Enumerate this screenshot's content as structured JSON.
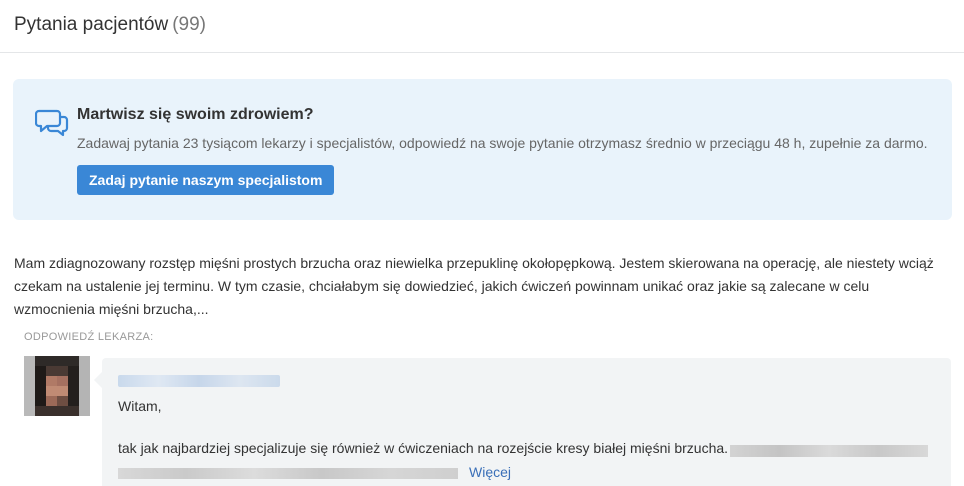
{
  "header": {
    "title": "Pytania pacjentów",
    "count": "(99)"
  },
  "banner": {
    "icon": "chat-bubbles-icon",
    "title": "Martwisz się swoim zdrowiem?",
    "description": "Zadawaj pytania 23 tysiącom lekarzy i specjalistów, odpowiedź na swoje pytanie otrzymasz średnio w przeciągu 48 h, zupełnie za darmo.",
    "button_label": "Zadaj pytanie naszym specjalistom"
  },
  "question": {
    "text": "Mam zdiagnozowany rozstęp mięśni prostych brzucha oraz niewielka przepuklinę okołopępkową. Jestem skierowana na operację, ale niestety wciąż czekam na ustalenie jej terminu. W tym czasie, chciałabym się dowiedzieć, jakich ćwiczeń powinnam unikać oraz jakie są zalecane w celu wzmocnienia mięśni brzucha,..."
  },
  "answer": {
    "label": "Odpowiedź lekarza:",
    "greeting": "Witam,",
    "text": "tak jak najbardziej specjalizuje się również w ćwiczeniach na rozejście kresy białej mięśni brzucha.",
    "more_label": "Więcej"
  }
}
